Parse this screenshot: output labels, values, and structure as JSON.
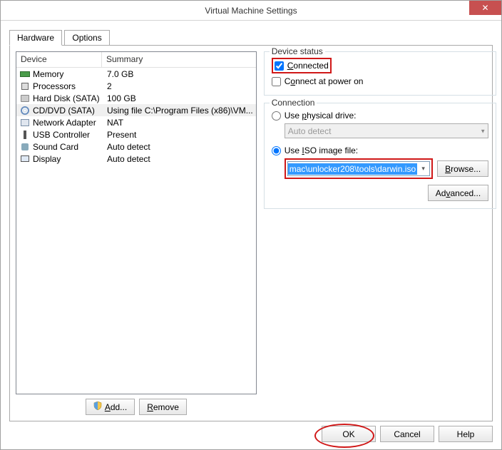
{
  "window": {
    "title": "Virtual Machine Settings"
  },
  "tabs": {
    "hardware": "Hardware",
    "options": "Options"
  },
  "listHeader": {
    "device": "Device",
    "summary": "Summary"
  },
  "devices": [
    {
      "name": "Memory",
      "summary": "7.0 GB",
      "icon": "mem"
    },
    {
      "name": "Processors",
      "summary": "2",
      "icon": "cpu"
    },
    {
      "name": "Hard Disk (SATA)",
      "summary": "100 GB",
      "icon": "hdd"
    },
    {
      "name": "CD/DVD (SATA)",
      "summary": "Using file C:\\Program Files (x86)\\VM...",
      "icon": "cd",
      "selected": true
    },
    {
      "name": "Network Adapter",
      "summary": "NAT",
      "icon": "net"
    },
    {
      "name": "USB Controller",
      "summary": "Present",
      "icon": "usb"
    },
    {
      "name": "Sound Card",
      "summary": "Auto detect",
      "icon": "snd"
    },
    {
      "name": "Display",
      "summary": "Auto detect",
      "icon": "disp"
    }
  ],
  "leftButtons": {
    "add": "Add...",
    "remove": "Remove"
  },
  "deviceStatus": {
    "legend": "Device status",
    "connected": "Connected",
    "connectedChecked": true,
    "connectAtPowerOn": "Connect at power on",
    "connectAtPowerOnChecked": false
  },
  "connection": {
    "legend": "Connection",
    "usePhysical_pre": "Use ",
    "usePhysical_u": "p",
    "usePhysical_post": "hysical drive:",
    "physicalCombo": "Auto detect",
    "useIso_pre": "Use ",
    "useIso_u": "I",
    "useIso_post": "SO image file:",
    "isoValue": "mac\\unlocker208\\tools\\darwin.iso",
    "browse_u": "B",
    "browse_post": "rowse...",
    "advanced_pre": "Ad",
    "advanced_u": "v",
    "advanced_post": "anced..."
  },
  "bottom": {
    "ok": "OK",
    "cancel": "Cancel",
    "help": "Help"
  }
}
